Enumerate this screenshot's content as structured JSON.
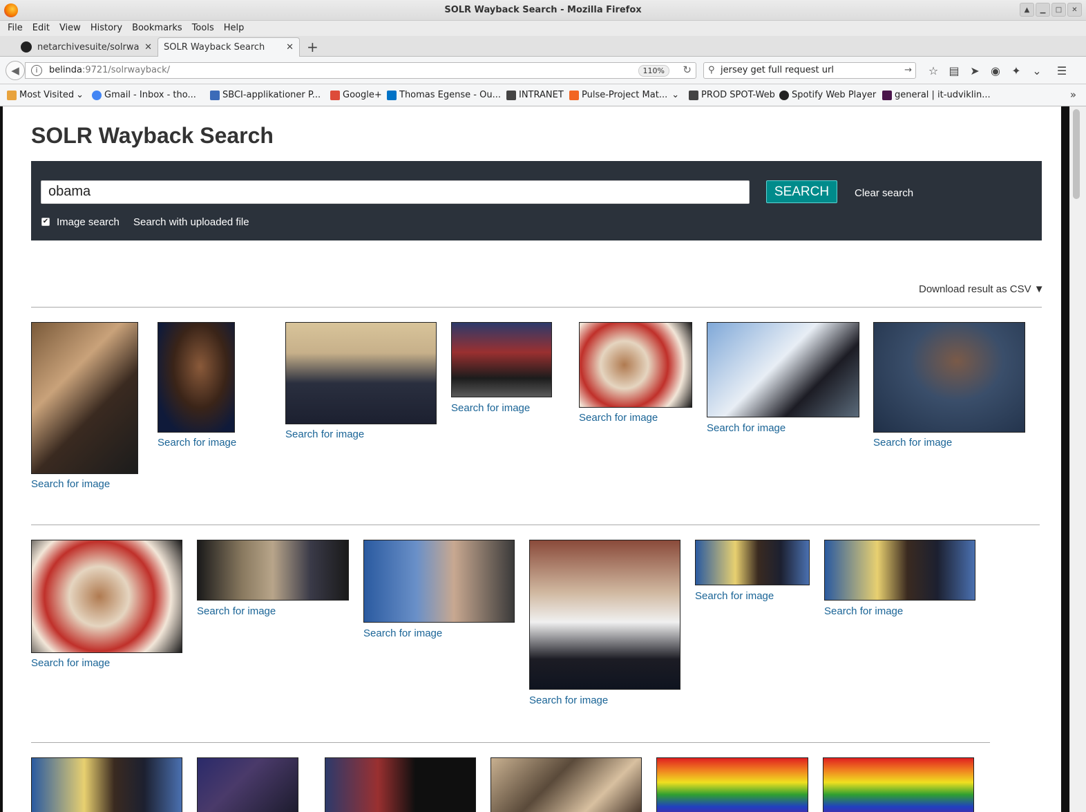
{
  "window": {
    "title": "SOLR Wayback Search - Mozilla Firefox"
  },
  "menu": [
    "File",
    "Edit",
    "View",
    "History",
    "Bookmarks",
    "Tools",
    "Help"
  ],
  "tabs": [
    {
      "label": "netarchivesuite/solrwa",
      "active": false
    },
    {
      "label": "SOLR Wayback Search",
      "active": true
    }
  ],
  "navbar": {
    "url_host": "belinda",
    "url_rest": ":9721/solrwayback/",
    "zoom": "110%",
    "search_value": "jersey get full request url"
  },
  "bookmarks": [
    {
      "label": "Most Visited",
      "icon": "folder-icon",
      "color": "#e8a33d"
    },
    {
      "label": "Gmail - Inbox - tho...",
      "icon": "google-icon",
      "color": "#4285f4"
    },
    {
      "label": "SBCI-applikationer P...",
      "icon": "sbci-icon",
      "color": "#3b6bb8"
    },
    {
      "label": "Google+",
      "icon": "google-plus-icon",
      "color": "#dd4b39"
    },
    {
      "label": "Thomas Egense - Ou...",
      "icon": "outlook-icon",
      "color": "#0072c6"
    },
    {
      "label": "INTRANET",
      "icon": "intranet-icon",
      "color": "#444444"
    },
    {
      "label": "Pulse-Project Mat...",
      "icon": "rss-icon",
      "color": "#f26522"
    },
    {
      "label": "PROD SPOT-Web",
      "icon": "list-icon",
      "color": "#444444"
    },
    {
      "label": "Spotify Web Player",
      "icon": "spotify-icon",
      "color": "#222222"
    },
    {
      "label": "general | it-udviklin...",
      "icon": "slack-icon",
      "color": "#4a154b"
    }
  ],
  "page": {
    "title": "SOLR Wayback Search",
    "query": "obama",
    "search_button": "SEARCH",
    "clear_search": "Clear search",
    "image_search_label": "Image search",
    "image_search_checked": true,
    "upload_label": "Search with uploaded file",
    "csv_label": "Download result as CSV ▼",
    "result_link": "Search for image"
  },
  "results": [
    {
      "description": "obama greeting crowd"
    },
    {
      "description": "obama speaking close-up"
    },
    {
      "description": "group photo with officers"
    },
    {
      "description": "obama at podium with flag"
    },
    {
      "description": "painted portrait on tv"
    },
    {
      "description": "couple boarding air force one"
    },
    {
      "description": "obama portrait blue background"
    },
    {
      "description": "painted portrait on tv"
    },
    {
      "description": "state visit handshake"
    },
    {
      "description": "press secretary white house"
    },
    {
      "description": "obama speech at rally"
    },
    {
      "description": "couple kiss on stage"
    },
    {
      "description": "couple kiss on stage"
    },
    {
      "description": "couple kiss on stage"
    },
    {
      "description": "obama dark stage"
    },
    {
      "description": "obama with flag"
    },
    {
      "description": "crowd with obama"
    },
    {
      "description": "rainbow overlay portrait"
    },
    {
      "description": "rainbow overlay portrait"
    }
  ]
}
